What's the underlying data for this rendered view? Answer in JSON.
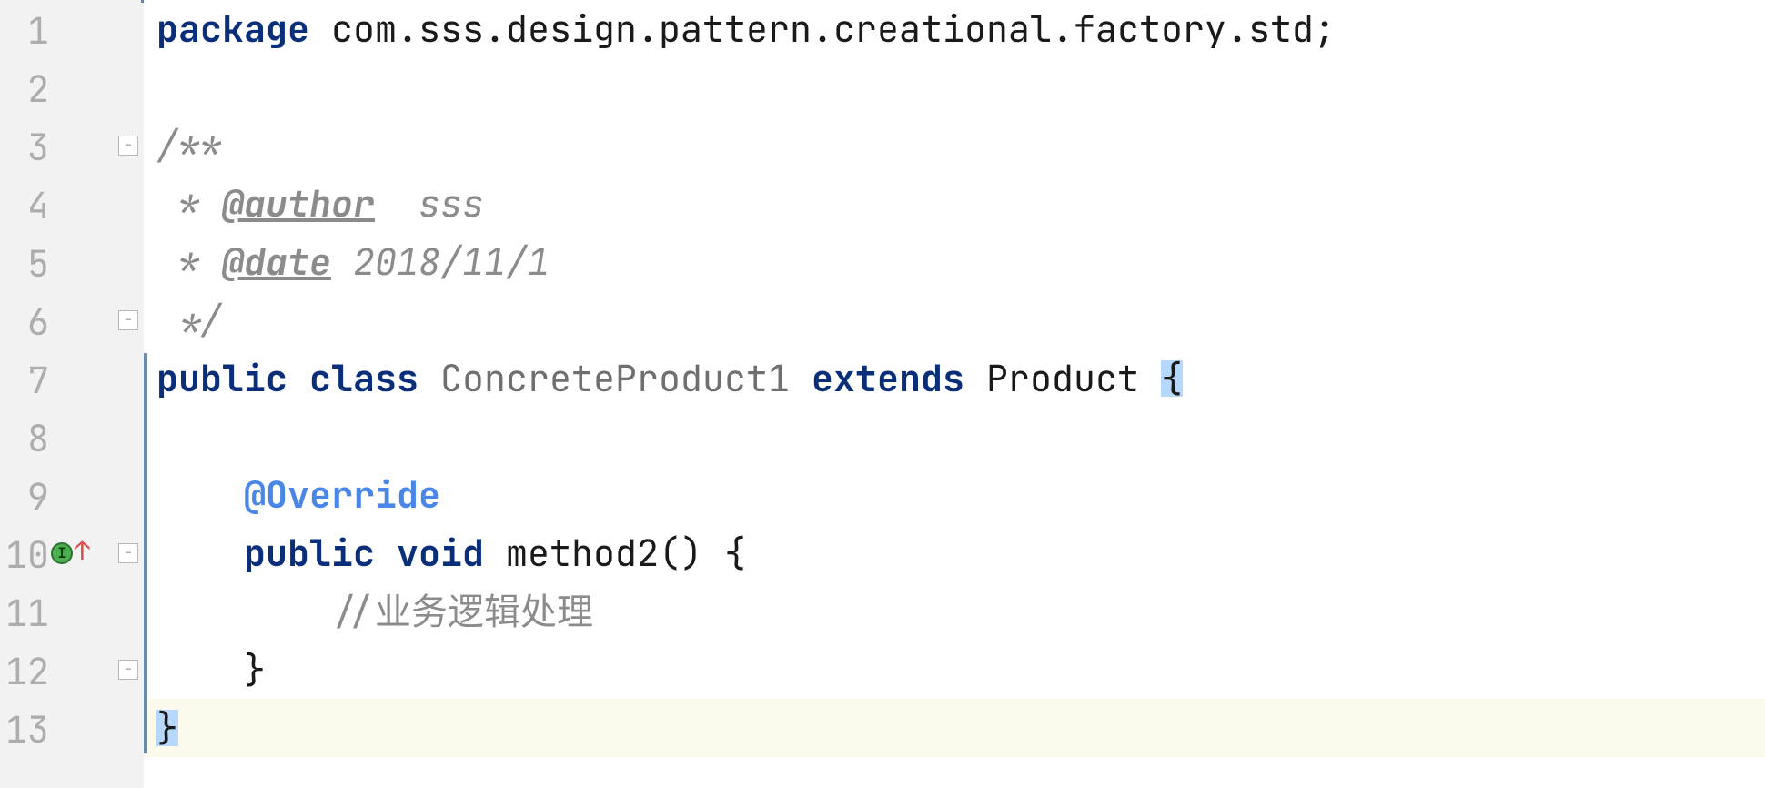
{
  "editor": {
    "line_height_px": 64,
    "first_visible_line": 1,
    "current_line": 13,
    "vcs_changed_lines": {
      "from": 7,
      "to": 13
    },
    "lines": [
      {
        "n": 1,
        "fold": null,
        "icons": [],
        "tokens": [
          {
            "cls": "kw",
            "t": "package"
          },
          {
            "cls": "id",
            "t": " com.sss.design.pattern.creational.factory.std;"
          }
        ]
      },
      {
        "n": 2,
        "fold": null,
        "icons": [],
        "tokens": []
      },
      {
        "n": 3,
        "fold": "open-down",
        "icons": [],
        "tokens": [
          {
            "cls": "comment",
            "t": "/**"
          }
        ]
      },
      {
        "n": 4,
        "fold": null,
        "icons": [],
        "tokens": [
          {
            "cls": "comment",
            "t": " * "
          },
          {
            "cls": "doctag",
            "t": "@author"
          },
          {
            "cls": "comment",
            "t": "  sss"
          }
        ]
      },
      {
        "n": 5,
        "fold": null,
        "icons": [],
        "tokens": [
          {
            "cls": "comment",
            "t": " * "
          },
          {
            "cls": "doctag",
            "t": "@date"
          },
          {
            "cls": "comment",
            "t": " 2018/11/1"
          }
        ]
      },
      {
        "n": 6,
        "fold": "open-up",
        "icons": [],
        "tokens": [
          {
            "cls": "comment",
            "t": " */"
          }
        ]
      },
      {
        "n": 7,
        "fold": null,
        "icons": [],
        "tokens": [
          {
            "cls": "kw",
            "t": "public"
          },
          {
            "cls": "id",
            "t": " "
          },
          {
            "cls": "kw",
            "t": "class"
          },
          {
            "cls": "id",
            "t": " "
          },
          {
            "cls": "cls",
            "t": "ConcreteProduct1"
          },
          {
            "cls": "id",
            "t": " "
          },
          {
            "cls": "kw",
            "t": "extends"
          },
          {
            "cls": "id",
            "t": " Product "
          },
          {
            "cls": "punct brace-hi",
            "t": "{"
          }
        ]
      },
      {
        "n": 8,
        "fold": null,
        "icons": [],
        "tokens": []
      },
      {
        "n": 9,
        "fold": null,
        "icons": [],
        "tokens": [
          {
            "cls": "id",
            "t": "    "
          },
          {
            "cls": "ann",
            "t": "@Override"
          }
        ]
      },
      {
        "n": 10,
        "fold": "open-down",
        "icons": [
          "override",
          "up"
        ],
        "tokens": [
          {
            "cls": "id",
            "t": "    "
          },
          {
            "cls": "kw",
            "t": "public"
          },
          {
            "cls": "id",
            "t": " "
          },
          {
            "cls": "kw",
            "t": "void"
          },
          {
            "cls": "id",
            "t": " method2() "
          },
          {
            "cls": "punct",
            "t": "{"
          }
        ]
      },
      {
        "n": 11,
        "fold": null,
        "icons": [],
        "tokens": [
          {
            "cls": "id",
            "t": "        "
          },
          {
            "cls": "greycmt",
            "t": "//业务逻辑处理"
          }
        ]
      },
      {
        "n": 12,
        "fold": "open-up",
        "icons": [],
        "tokens": [
          {
            "cls": "id",
            "t": "    "
          },
          {
            "cls": "punct",
            "t": "}"
          }
        ]
      },
      {
        "n": 13,
        "fold": null,
        "icons": [],
        "tokens": [
          {
            "cls": "punct brace-hi",
            "t": "}"
          }
        ]
      }
    ]
  }
}
